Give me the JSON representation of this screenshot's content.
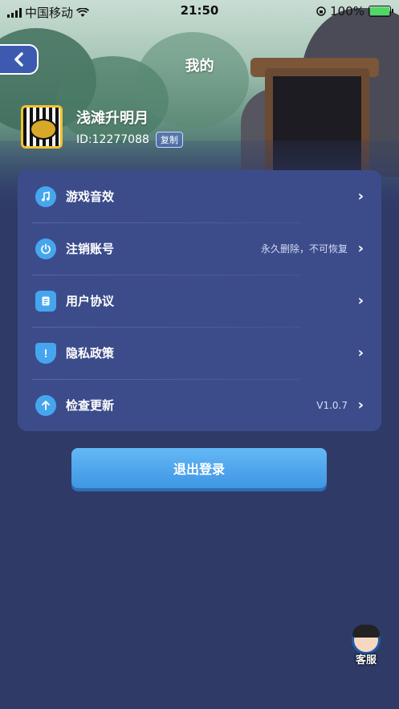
{
  "status_bar": {
    "carrier": "中国移动",
    "time": "21:50",
    "battery": "100%",
    "battery_level": 1.0
  },
  "header": {
    "title": "我的"
  },
  "profile": {
    "username": "浅滩升明月",
    "id_text": "ID:12277088",
    "copy_label": "复制"
  },
  "settings": {
    "items": [
      {
        "icon": "music-note-icon",
        "label": "游戏音效",
        "sub": ""
      },
      {
        "icon": "power-icon",
        "label": "注销账号",
        "sub": "永久删除，不可恢复"
      },
      {
        "icon": "document-icon",
        "label": "用户协议",
        "sub": ""
      },
      {
        "icon": "shield-icon",
        "label": "隐私政策",
        "sub": ""
      },
      {
        "icon": "arrow-up-icon",
        "label": "检查更新",
        "sub": "V1.0.7"
      }
    ]
  },
  "logout": {
    "label": "退出登录"
  },
  "customer_service": {
    "label": "客服"
  },
  "colors": {
    "background": "#2f3a67",
    "card": "#3c4c8b",
    "accent": "#45a6ee",
    "button": "#4fa6ec"
  }
}
